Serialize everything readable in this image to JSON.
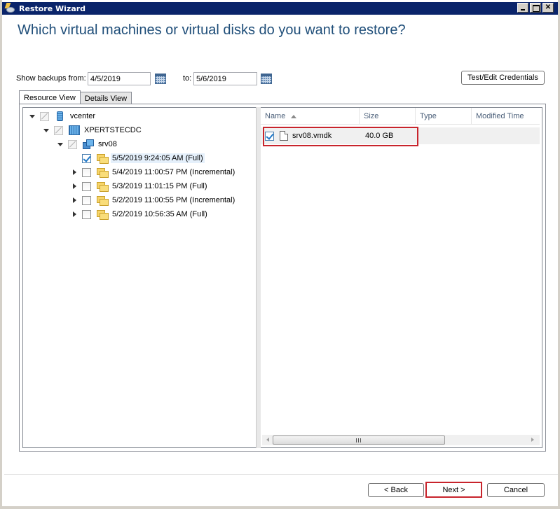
{
  "window": {
    "title": "Restore Wizard",
    "controls": [
      "minimize",
      "maximize",
      "close"
    ],
    "close_glyph": "✕"
  },
  "heading": "Which virtual machines or virtual disks do you want to restore?",
  "filters": {
    "from_label": "Show backups from:",
    "from_value": "4/5/2019",
    "to_label": "to:",
    "to_value": "5/6/2019",
    "calendar_icon": "calendar-icon"
  },
  "credentials_button": "Test/Edit Credentials",
  "tabs": [
    {
      "label": "Resource View",
      "active": true
    },
    {
      "label": "Details View",
      "active": false
    }
  ],
  "tree": [
    {
      "label": "vcenter",
      "icon": "vcenter-icon",
      "expander": "down",
      "check": "partial",
      "level": 0
    },
    {
      "label": "XPERTSTECDC",
      "icon": "datacenter-icon",
      "expander": "down",
      "check": "partial",
      "level": 1
    },
    {
      "label": "srv08",
      "icon": "vm-icon",
      "expander": "down",
      "check": "partial",
      "level": 2
    },
    {
      "label": "5/5/2019 9:24:05 AM (Full)",
      "icon": "backup-icon",
      "expander": "none",
      "check": "checked",
      "level": 3,
      "selected": true
    },
    {
      "label": "5/4/2019 11:00:57 PM (Incremental)",
      "icon": "backup-icon",
      "expander": "right",
      "check": "unchecked",
      "level": 3
    },
    {
      "label": "5/3/2019 11:01:15 PM (Full)",
      "icon": "backup-icon",
      "expander": "right",
      "check": "unchecked",
      "level": 3
    },
    {
      "label": "5/2/2019 11:00:55 PM (Incremental)",
      "icon": "backup-icon",
      "expander": "right",
      "check": "unchecked",
      "level": 3
    },
    {
      "label": "5/2/2019 10:56:35 AM (Full)",
      "icon": "backup-icon",
      "expander": "right",
      "check": "unchecked",
      "level": 3
    }
  ],
  "list": {
    "columns": [
      {
        "label": "Name",
        "sorted": "ascending"
      },
      {
        "label": "Size"
      },
      {
        "label": "Type"
      },
      {
        "label": "Modified Time"
      }
    ],
    "rows": [
      {
        "checked": true,
        "name": "srv08.vmdk",
        "size": "40.0 GB",
        "type": "",
        "modified": ""
      }
    ],
    "scrollbar_grip": "III"
  },
  "footer": {
    "back": "< Back",
    "next": "Next >",
    "cancel": "Cancel"
  }
}
